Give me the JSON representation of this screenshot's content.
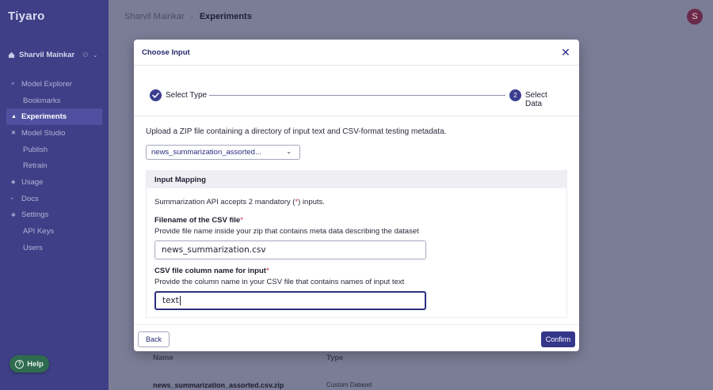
{
  "app": {
    "logo": "Tiyaro"
  },
  "sidebar": {
    "user_name": "Sharvil Mainkar",
    "items": [
      {
        "label": "Model Explorer",
        "icon": "search-icon",
        "sub": false,
        "active": false
      },
      {
        "label": "Bookmarks",
        "sub": true,
        "active": false
      },
      {
        "label": "Experiments",
        "icon": "flask-icon",
        "sub": false,
        "active": true
      },
      {
        "label": "Model Studio",
        "icon": "tools-icon",
        "sub": false,
        "active": false
      },
      {
        "label": "Publish",
        "sub": true,
        "active": false
      },
      {
        "label": "Retrain",
        "sub": true,
        "active": false
      },
      {
        "label": "Usage",
        "icon": "chart-icon",
        "sub": false,
        "active": false
      },
      {
        "label": "Docs",
        "icon": "doc-icon",
        "sub": false,
        "active": false
      },
      {
        "label": "Settings",
        "icon": "gear-icon",
        "sub": false,
        "active": false
      },
      {
        "label": "API Keys",
        "sub": true,
        "active": false
      },
      {
        "label": "Users",
        "sub": true,
        "active": false
      }
    ],
    "help_label": "Help"
  },
  "header": {
    "breadcrumb_root": "Sharvil Mainkar",
    "breadcrumb_sep": "›",
    "breadcrumb_current": "Experiments",
    "avatar_initial": "S"
  },
  "background_table": {
    "col_name": "Name",
    "col_type": "Type",
    "row_name": "news_summarization_assorted.csv.zip",
    "row_type": "Custom Dataset"
  },
  "modal": {
    "title": "Choose Input",
    "steps": [
      {
        "label": "Select Type",
        "state": "done"
      },
      {
        "label": "Select Data",
        "number": "2",
        "state": "current"
      }
    ],
    "upload_text": "Upload a ZIP file containing a directory of input text and CSV-format testing metadata.",
    "selected_file": "news_summarization_assorted...",
    "mapping": {
      "heading": "Input Mapping",
      "accepts_prefix": "Summarization API accepts 2 mandatory (",
      "accepts_star": "*",
      "accepts_suffix": ") inputs.",
      "field1_label": "Filename of the CSV file",
      "field1_help": "Provide file name inside your zip that contains meta data describing the dataset",
      "field1_value": "news_summarization.csv",
      "field2_label": "CSV file column name for input",
      "field2_help": "Provide the column name in your CSV file that contains names of input text",
      "field2_value": "text",
      "required_mark": "*"
    },
    "back_label": "Back",
    "confirm_label": "Confirm"
  },
  "colors": {
    "sidebar_bg": "#3e3f86",
    "accent": "#34368a",
    "required": "#c0263a",
    "help_bg": "#2f6b4e"
  }
}
